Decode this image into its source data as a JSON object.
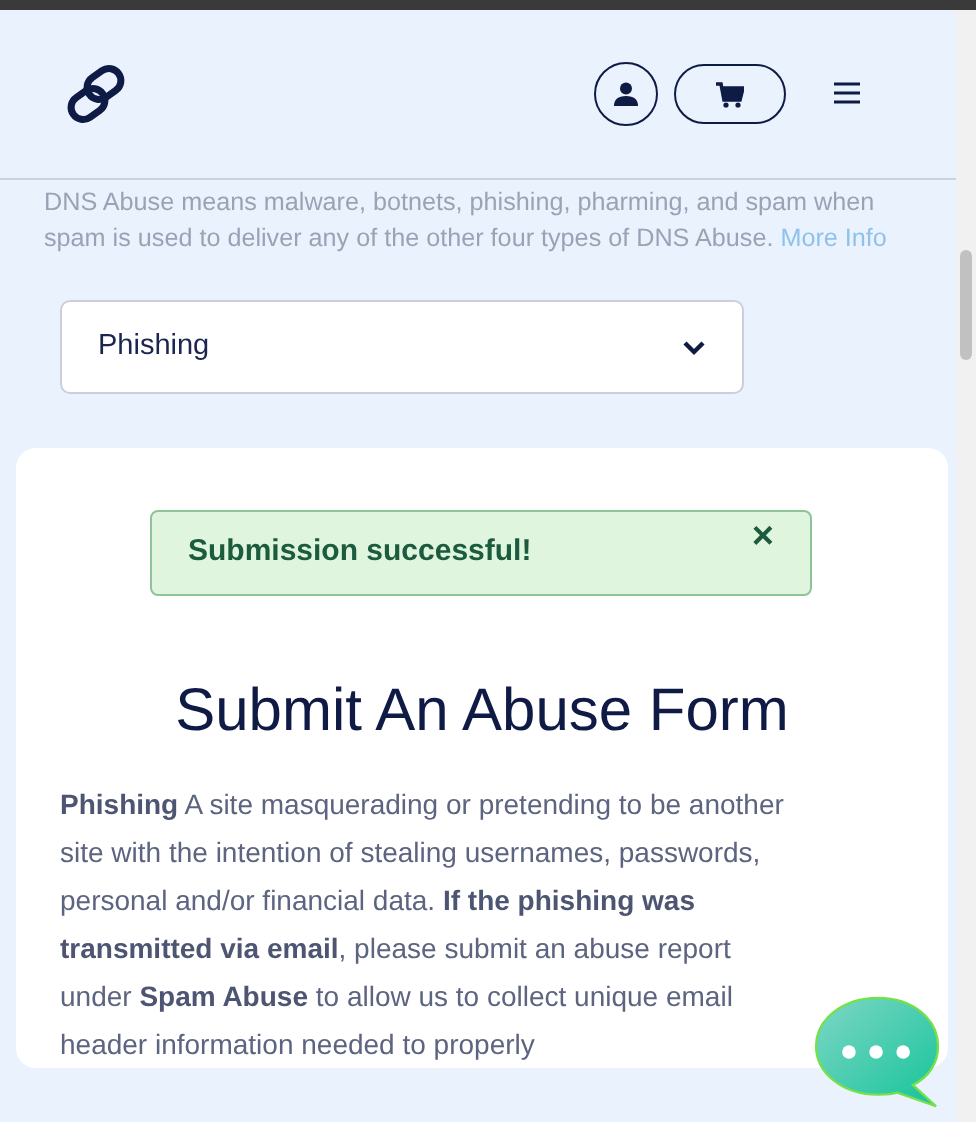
{
  "intro": {
    "text": "DNS Abuse means malware, botnets, phishing, pharming, and spam when spam is used to deliver any of the other four types of DNS Abuse.",
    "link": "More Info"
  },
  "abuse_type_select": {
    "value": "Phishing"
  },
  "alert": {
    "message": "Submission successful!",
    "close": "×"
  },
  "form": {
    "title": "Submit An Abuse Form",
    "description": "**Phishing** A site masquerading or pretending to be another site with the intention of stealing usernames, passwords, personal and/or financial data. **If the phishing was transmitted via email**, please submit an abuse report under **Spam Abuse** to allow us to collect unique email header information needed to properly"
  }
}
